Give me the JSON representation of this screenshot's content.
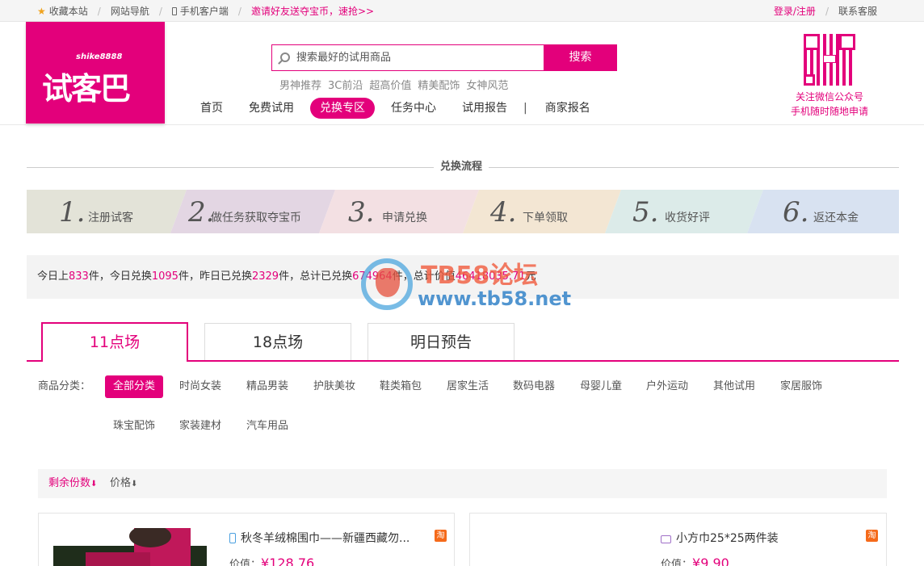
{
  "topbar": {
    "favorite": "收藏本站",
    "site_nav": "网站导航",
    "mobile_client": "手机客户端",
    "invite": "邀请好友送夺宝币，速抢>>",
    "login": "登录/注册",
    "support": "联系客服"
  },
  "logo": {
    "sub": "shike8888",
    "main": "试客巴"
  },
  "search": {
    "placeholder": "搜索最好的试用商品",
    "button": "搜索"
  },
  "hotwords": [
    "男神推荐",
    "3C前沿",
    "超高价值",
    "精美配饰",
    "女神风范"
  ],
  "nav": {
    "items": [
      "首页",
      "免费试用",
      "兑换专区",
      "任务中心",
      "试用报告",
      "商家报名"
    ],
    "active_index": 2
  },
  "qr": {
    "line1": "关注微信公众号",
    "line2": "手机随时随地申请"
  },
  "process": {
    "title": "兑换流程",
    "steps": [
      {
        "num": "1.",
        "label": "注册试客",
        "color": "#e3e3d8"
      },
      {
        "num": "2.",
        "label": "做任务获取夺宝币",
        "color": "#e3d6e3"
      },
      {
        "num": "3.",
        "label": "申请兑换",
        "color": "#f3e0e3"
      },
      {
        "num": "4.",
        "label": "下单领取",
        "color": "#f3e6d3"
      },
      {
        "num": "5.",
        "label": "收货好评",
        "color": "#dcebe9"
      },
      {
        "num": "6.",
        "label": "返还本金",
        "color": "#d8e2f1"
      }
    ]
  },
  "stats": {
    "p1": "今日上",
    "v1": "833",
    "p2": "件，今日兑换",
    "v2": "1095",
    "p3": "件，昨日已兑换",
    "v3": "2329",
    "p4": "件，总计已兑换",
    "v4": "674964",
    "p5": "件，总计价值",
    "v5": "46418035.71",
    "p6": "元"
  },
  "watermark": {
    "line1": "TB58论坛",
    "line2": "www.tb58.net"
  },
  "tabs": [
    "11点场",
    "18点场",
    "明日预告"
  ],
  "categories": {
    "label": "商品分类：",
    "items": [
      "全部分类",
      "时尚女装",
      "精品男装",
      "护肤美妆",
      "鞋类箱包",
      "居家生活",
      "数码电器",
      "母婴儿童",
      "户外运动",
      "其他试用",
      "家居服饰",
      "珠宝配饰",
      "家装建材",
      "汽车用品"
    ]
  },
  "sort": {
    "remaining": "剩余份数",
    "price": "价格"
  },
  "products": [
    {
      "title": "秋冬羊绒棉围巾——新疆西藏勿...",
      "price_label": "价值：",
      "price": "¥128.76",
      "tao": "淘"
    },
    {
      "title": "小方巾25*25两件装",
      "price_label": "价值：",
      "price": "¥9.90",
      "tao": "淘"
    }
  ],
  "colors": {
    "accent": "#e3007b"
  }
}
